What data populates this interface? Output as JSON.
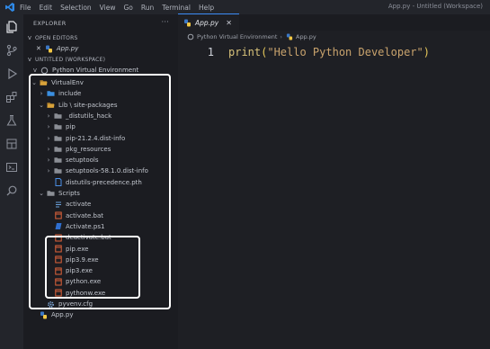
{
  "titlebar": {
    "menu": [
      "File",
      "Edit",
      "Selection",
      "View",
      "Go",
      "Run",
      "Terminal",
      "Help"
    ],
    "window_title": "App.py - Untitled (Workspace)"
  },
  "activity": [
    "files-icon",
    "source-control-icon",
    "run-debug-icon",
    "extensions-icon",
    "testing-icon",
    "remote-icon",
    "terminal-icon",
    "search-icon"
  ],
  "sidebar": {
    "title": "EXPLORER",
    "open_editors": "OPEN EDITORS",
    "open_file": "App.py",
    "workspace": "UNTITLED (WORKSPACE)",
    "root": "Python Virtual Environment",
    "tree": [
      {
        "label": "VirtualEnv",
        "depth": 1,
        "kind": "folder-open",
        "chev": "v"
      },
      {
        "label": "include",
        "depth": 2,
        "kind": "folder-include",
        "chev": ">"
      },
      {
        "label": "Lib \\ site-packages",
        "depth": 2,
        "kind": "folder-open",
        "chev": "v"
      },
      {
        "label": "_distutils_hack",
        "depth": 3,
        "kind": "folder",
        "chev": ">"
      },
      {
        "label": "pip",
        "depth": 3,
        "kind": "folder",
        "chev": ">"
      },
      {
        "label": "pip-21.2.4.dist-info",
        "depth": 3,
        "kind": "folder",
        "chev": ">"
      },
      {
        "label": "pkg_resources",
        "depth": 3,
        "kind": "folder",
        "chev": ">"
      },
      {
        "label": "setuptools",
        "depth": 3,
        "kind": "folder",
        "chev": ">"
      },
      {
        "label": "setuptools-58.1.0.dist-info",
        "depth": 3,
        "kind": "folder",
        "chev": ">"
      },
      {
        "label": "distutils-precedence.pth",
        "depth": 3,
        "kind": "file-blue",
        "chev": ""
      },
      {
        "label": "Scripts",
        "depth": 2,
        "kind": "folder-scripts",
        "chev": "v"
      },
      {
        "label": "activate",
        "depth": 3,
        "kind": "file-plain",
        "chev": ""
      },
      {
        "label": "activate.bat",
        "depth": 3,
        "kind": "file-red",
        "chev": ""
      },
      {
        "label": "Activate.ps1",
        "depth": 3,
        "kind": "file-ps",
        "chev": ""
      },
      {
        "label": "deactivate.bat",
        "depth": 3,
        "kind": "file-red",
        "chev": ""
      },
      {
        "label": "pip.exe",
        "depth": 3,
        "kind": "file-red",
        "chev": ""
      },
      {
        "label": "pip3.9.exe",
        "depth": 3,
        "kind": "file-red",
        "chev": ""
      },
      {
        "label": "pip3.exe",
        "depth": 3,
        "kind": "file-red",
        "chev": ""
      },
      {
        "label": "python.exe",
        "depth": 3,
        "kind": "file-red",
        "chev": ""
      },
      {
        "label": "pythonw.exe",
        "depth": 3,
        "kind": "file-red",
        "chev": ""
      },
      {
        "label": "pyvenv.cfg",
        "depth": 2,
        "kind": "file-gear",
        "chev": ""
      },
      {
        "label": "App.py",
        "depth": 1,
        "kind": "file-python",
        "chev": ""
      }
    ]
  },
  "editor": {
    "tab_label": "App.py",
    "breadcrumb": [
      "Python Virtual Environment",
      "App.py"
    ],
    "line_number": "1",
    "code_fn": "print",
    "code_open": "(",
    "code_str": "\"Hello Python Developer\"",
    "code_close": ")"
  },
  "colors": {
    "accent": "#3c8df7",
    "folder": "#d9a33b",
    "exe": "#e0633a",
    "python": "#f2c744"
  }
}
